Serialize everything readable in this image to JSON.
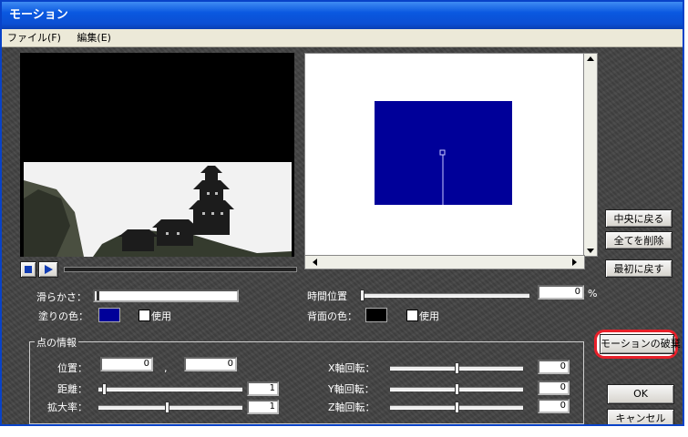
{
  "window": {
    "title": "モーション"
  },
  "menu": [
    {
      "label": "ファイル(F)"
    },
    {
      "label": "編集(E)"
    }
  ],
  "side_buttons": {
    "center": "中央に戻る",
    "delete_all": "全てを削除",
    "reset": "最初に戻す",
    "discard": "モーションの破棄",
    "ok": "OK",
    "cancel": "キャンセル"
  },
  "labels": {
    "smoothness": "滑らかさ：",
    "fill_color": "塗りの色：",
    "use": "使用",
    "time_position": "時間位置",
    "percent": "%",
    "background_color": "背面の色：",
    "point_info": "点の情報",
    "position": "位置：",
    "separator": ",",
    "distance": "距離：",
    "scale": "拡大率：",
    "x_rotation": "X軸回転：",
    "y_rotation": "Y軸回転：",
    "z_rotation": "Z軸回転："
  },
  "values": {
    "time_position": "0",
    "position_x": "0",
    "position_y": "0",
    "distance": "1",
    "scale": "1",
    "x_rotation": "0",
    "y_rotation": "0",
    "z_rotation": "0"
  },
  "colors": {
    "fill": "#000099",
    "background": "#000000",
    "accent": "#0a58e0",
    "highlight": "#e8202a"
  }
}
